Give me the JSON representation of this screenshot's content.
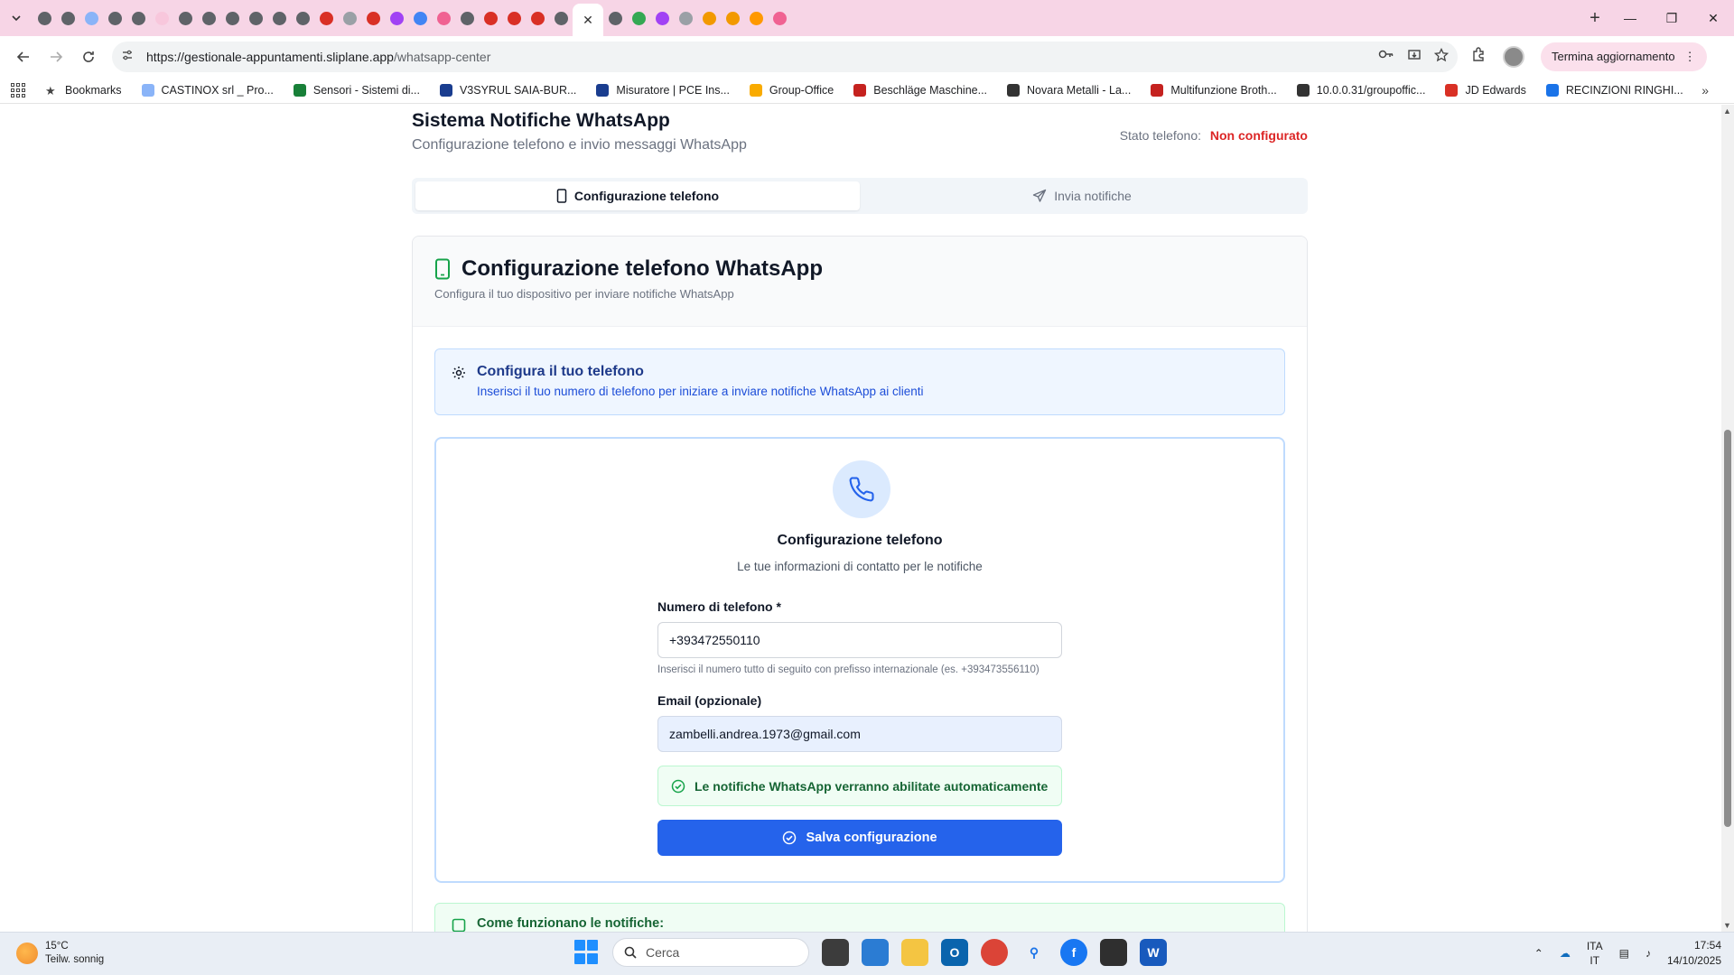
{
  "browser": {
    "url_host": "https://gestionale-appuntamenti.sliplane.app",
    "url_path": "/whatsapp-center",
    "update_button": "Termina aggiornamento",
    "tab_favicon_colors": [
      "#5f6368",
      "#5f6368",
      "#8ab4f8",
      "#5f6368",
      "#5f6368",
      "#f8c7dc",
      "#5f6368",
      "#5f6368",
      "#5f6368",
      "#5f6368",
      "#5f6368",
      "#5f6368",
      "#d93025",
      "#9aa0a6",
      "#d93025",
      "#a142f4",
      "#4285f4",
      "#f06292",
      "#5f6368",
      "#d93025",
      "#d93025",
      "#d93025",
      "#5f6368",
      "#5f6368",
      "#34a853",
      "#a142f4",
      "#9aa0a6",
      "#f29900",
      "#f29900",
      "#ff9900",
      "#f06292"
    ]
  },
  "bookmarks": [
    {
      "label": "Bookmarks",
      "color": "#444444"
    },
    {
      "label": "CASTINOX srl _ Pro...",
      "color": "#8ab4f8"
    },
    {
      "label": "Sensori - Sistemi di...",
      "color": "#188038"
    },
    {
      "label": "V3SYRUL SAIA-BUR...",
      "color": "#1a3d8f"
    },
    {
      "label": "Misuratore | PCE Ins...",
      "color": "#1a3d8f"
    },
    {
      "label": "Group-Office",
      "color": "#f9ab00"
    },
    {
      "label": "Beschläge Maschine...",
      "color": "#c5221f"
    },
    {
      "label": "Novara Metalli - La...",
      "color": "#333333"
    },
    {
      "label": "Multifunzione Broth...",
      "color": "#c5221f"
    },
    {
      "label": "10.0.0.31/groupoffic...",
      "color": "#333333"
    },
    {
      "label": "JD Edwards",
      "color": "#d93025"
    },
    {
      "label": "RECINZIONI RINGHI...",
      "color": "#1a73e8"
    }
  ],
  "header": {
    "title": "Sistema Notifiche WhatsApp",
    "subtitle": "Configurazione telefono e invio messaggi WhatsApp",
    "status_label": "Stato telefono:",
    "status_value": "Non configurato"
  },
  "tabs": [
    {
      "label": "Configurazione telefono",
      "icon": "smartphone-icon",
      "active": true
    },
    {
      "label": "Invia notifiche",
      "icon": "send-icon",
      "active": false
    }
  ],
  "card": {
    "title": "Configurazione telefono WhatsApp",
    "subtitle": "Configura il tuo dispositivo per inviare notifiche WhatsApp"
  },
  "info": {
    "title": "Configura il tuo telefono",
    "text": "Inserisci il tuo numero di telefono per iniziare a inviare notifiche WhatsApp ai clienti"
  },
  "form": {
    "title": "Configurazione telefono",
    "subtitle": "Le tue informazioni di contatto per le notifiche",
    "phone_label": "Numero di telefono *",
    "phone_value": "+393472550110",
    "phone_help": "Inserisci il numero tutto di seguito con prefisso internazionale (es. +393473556110)",
    "email_label": "Email (opzionale)",
    "email_value": "zambelli.andrea.1973@gmail.com",
    "success_text": "Le notifiche WhatsApp verranno abilitate automaticamente",
    "save_label": "Salva configurazione"
  },
  "how": {
    "title": "Come funzionano le notifiche:"
  },
  "taskbar": {
    "temp": "15°C",
    "weather": "Teilw. sonnig",
    "search_placeholder": "Cerca",
    "lang_1": "ITA",
    "lang_2": "IT",
    "time": "17:54",
    "date": "14/10/2025"
  },
  "colors": {
    "primary": "#2563eb",
    "status_error": "#dc2626",
    "success": "#166534",
    "tabstrip": "#f7d5e6"
  }
}
